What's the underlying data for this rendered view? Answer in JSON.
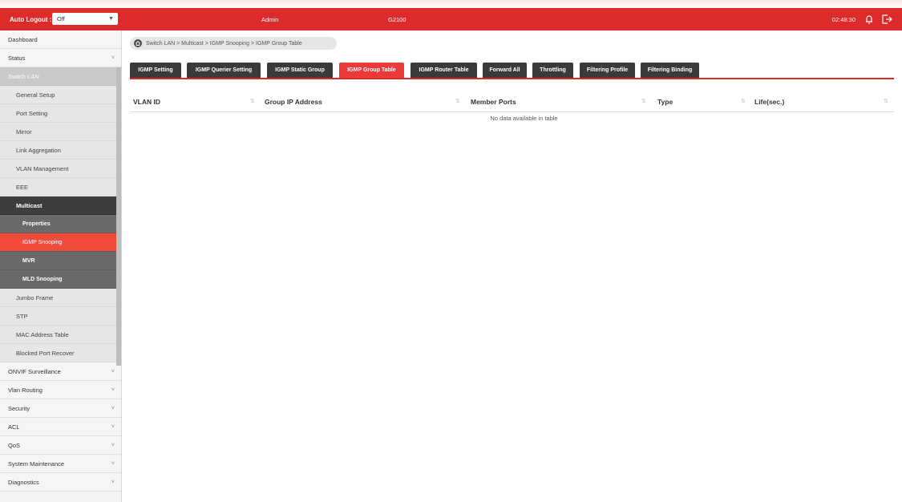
{
  "header": {
    "auto_logout_label": "Auto Logout :",
    "auto_logout_value": "Off",
    "user": "Admin",
    "model": "G2100",
    "time": "02:48:30",
    "accent_color": "#dd2a2a"
  },
  "sidebar": {
    "items": [
      {
        "label": "Dashboard"
      },
      {
        "label": "Status"
      },
      {
        "label": "Switch LAN"
      }
    ],
    "switch_lan": [
      {
        "label": "General Setup"
      },
      {
        "label": "Port Setting"
      },
      {
        "label": "Mirror"
      },
      {
        "label": "Link Aggregation"
      },
      {
        "label": "VLAN Management"
      },
      {
        "label": "EEE"
      }
    ],
    "multicast_label": "Multicast",
    "multicast": [
      {
        "label": "Properties"
      },
      {
        "label": "IGMP Snooping"
      },
      {
        "label": "MVR"
      },
      {
        "label": "MLD Snooping"
      }
    ],
    "switch_lan_after": [
      {
        "label": "Jumbo Frame"
      },
      {
        "label": "STP"
      },
      {
        "label": "MAC Address Table"
      },
      {
        "label": "Blocked Port Recover"
      }
    ],
    "bottom": [
      {
        "label": "ONVIF Surveillance"
      },
      {
        "label": "Vlan Routing"
      },
      {
        "label": "Security"
      },
      {
        "label": "ACL"
      },
      {
        "label": "QoS"
      },
      {
        "label": "System Maintenance"
      },
      {
        "label": "Diagnostics"
      }
    ]
  },
  "breadcrumb": "Switch LAN > Multicast > IGMP Snooping > IGMP Group Table",
  "tabs": [
    {
      "label": "IGMP Setting"
    },
    {
      "label": "IGMP Querier Setting"
    },
    {
      "label": "IGMP Static Group"
    },
    {
      "label": "IGMP Group Table"
    },
    {
      "label": "IGMP Router Table"
    },
    {
      "label": "Forward All"
    },
    {
      "label": "Throttling"
    },
    {
      "label": "Filtering Profile"
    },
    {
      "label": "Filtering Binding"
    }
  ],
  "active_tab": "IGMP Group Table",
  "table": {
    "columns": [
      "VLAN ID",
      "Group IP Address",
      "Member Ports",
      "Type",
      "Life(sec.)"
    ],
    "empty_text": "No data available in table"
  }
}
